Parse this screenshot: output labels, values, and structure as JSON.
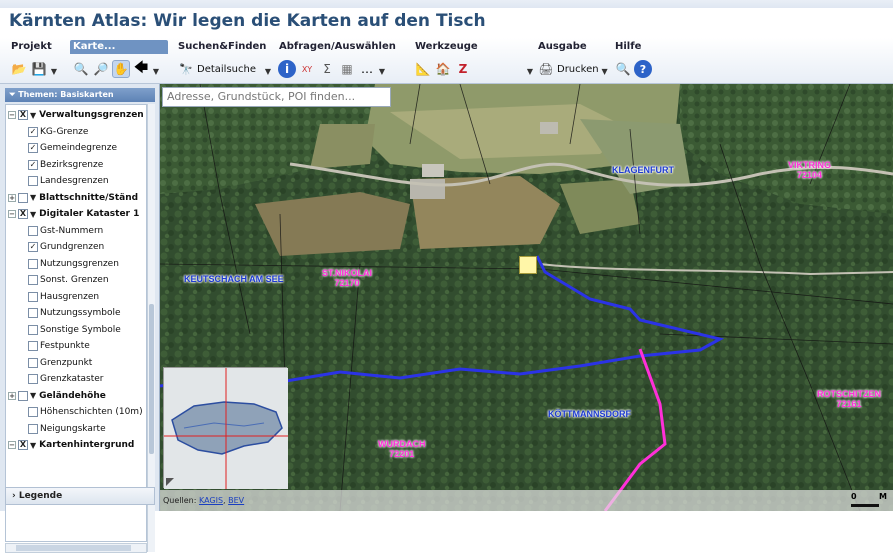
{
  "app": {
    "title": "Kärnten Atlas: Wir legen die Karten auf den Tisch"
  },
  "ribbon": {
    "groups": [
      {
        "label": "Projekt"
      },
      {
        "label": "Karte..."
      },
      {
        "label": "Suchen&Finden",
        "button": "Detailsuche"
      },
      {
        "label": "Abfragen/Auswählen"
      },
      {
        "label": "Werkzeuge"
      },
      {
        "label": "Ausgabe",
        "button": "Drucken"
      },
      {
        "label": "Hilfe"
      }
    ]
  },
  "sidebar": {
    "header": "Themen: Basiskarten",
    "legend": "Legende",
    "tree": [
      {
        "label": "Verwaltungsgrenzen",
        "level": 0,
        "checked": "X",
        "bold": true
      },
      {
        "label": "KG-Grenze",
        "level": 1,
        "checked": "✓"
      },
      {
        "label": "Gemeindegrenze",
        "level": 1,
        "checked": "✓"
      },
      {
        "label": "Bezirksgrenze",
        "level": 1,
        "checked": "✓"
      },
      {
        "label": "Landesgrenzen",
        "level": 1,
        "checked": ""
      },
      {
        "label": "Blattschnitte/Ständ",
        "level": 0,
        "checked": "",
        "bold": true
      },
      {
        "label": "Digitaler Kataster 1",
        "level": 0,
        "checked": "X",
        "bold": true
      },
      {
        "label": "Gst-Nummern",
        "level": 1,
        "checked": ""
      },
      {
        "label": "Grundgrenzen",
        "level": 1,
        "checked": "✓"
      },
      {
        "label": "Nutzungsgrenzen",
        "level": 1,
        "checked": ""
      },
      {
        "label": "Sonst. Grenzen",
        "level": 1,
        "checked": ""
      },
      {
        "label": "Hausgrenzen",
        "level": 1,
        "checked": ""
      },
      {
        "label": "Nutzungssymbole",
        "level": 1,
        "checked": ""
      },
      {
        "label": "Sonstige Symbole",
        "level": 1,
        "checked": ""
      },
      {
        "label": "Festpunkte",
        "level": 1,
        "checked": ""
      },
      {
        "label": "Grenzpunkt",
        "level": 1,
        "checked": ""
      },
      {
        "label": "Grenzkataster",
        "level": 1,
        "checked": ""
      },
      {
        "label": "Geländehöhe",
        "level": 0,
        "checked": "",
        "bold": true
      },
      {
        "label": "Höhenschichten (10m)",
        "level": 1,
        "checked": ""
      },
      {
        "label": "Neigungskarte",
        "level": 1,
        "checked": ""
      },
      {
        "label": "Kartenhintergrund",
        "level": 0,
        "checked": "X",
        "bold": true
      }
    ]
  },
  "map": {
    "search_placeholder": "Adresse, Grundstück, POI finden...",
    "labels": {
      "klagenfurt": "KLAGENFURT",
      "viktring": "VIKTRING",
      "viktring_code": "72104",
      "keutschach": "KEUTSCHACH AM SEE",
      "stnikolai": "ST.NIKOLAI",
      "stnikolai_code": "72170",
      "koettmannsdorf": "KÖTTMANNSDORF",
      "wurdach": "WURDACH",
      "wurdach_code": "72201",
      "rotschitzen": "ROTSCHITZEN",
      "rotschitzen_code": "72161"
    },
    "sources_prefix": "Quellen:",
    "sources": [
      "KAGIS",
      "BEV"
    ],
    "scale_zero": "0",
    "scale_unit": "M"
  }
}
